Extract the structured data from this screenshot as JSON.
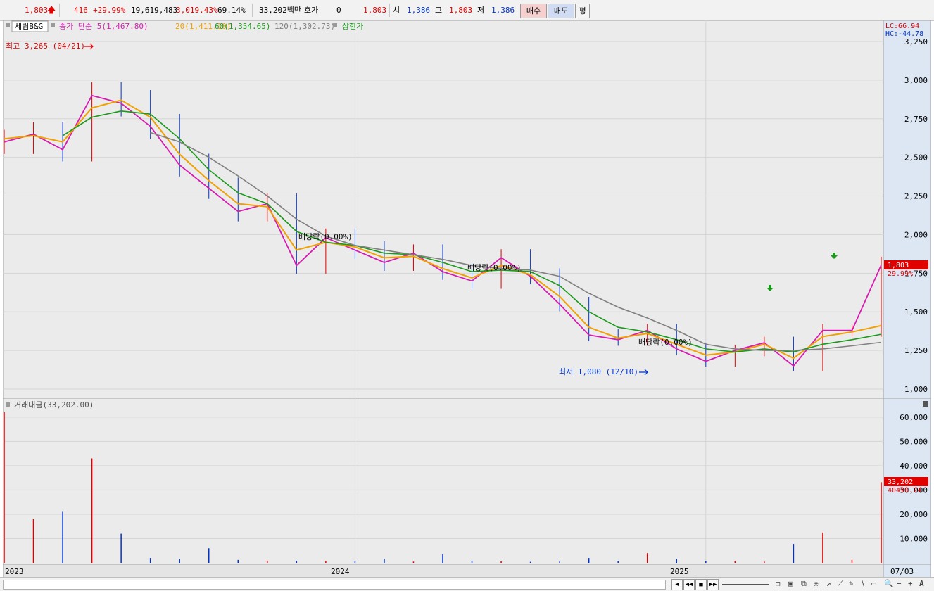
{
  "quote": {
    "price": "1,803",
    "change": "416",
    "change_pct": "+29.99%",
    "volume": "19,619,483",
    "vol_ratio": "3,019.43%",
    "turnover_rate": "69.14%",
    "amount": "33,202백만",
    "bid_label": "호가",
    "bid_value": "0",
    "bid_price": "1,803",
    "open_label": "시",
    "open_value": "1,386",
    "high_label": "고",
    "high_value": "1,803",
    "low_label": "저",
    "low_value": "1,386",
    "buy_label": "매수",
    "sell_label": "매도",
    "eval_label": "평"
  },
  "colors": {
    "up": "#e00000",
    "down": "#0033cc",
    "ma5": "#d81bb0",
    "ma20": "#f0a000",
    "ma60": "#1a9a1a",
    "ma120": "#808080",
    "grid": "#d6d6d6",
    "panel_bg": "#ebebeb",
    "axis_bg": "#dde7f3"
  },
  "price_panel": {
    "legend": {
      "stock_name": "세림B&G",
      "ma_label": "종가 단순 5(1,467.80)",
      "ma20_label": "20(1,411.10)",
      "ma60_label": "60(1,354.65)",
      "ma120_label": "120(1,302.73)",
      "limit_label": "상한가"
    },
    "lc_text": "LC:66.94",
    "hc_text": "HC:-44.78",
    "high_annotation": "최고 3,265 (04/21)",
    "low_annotation": "최저 1,080 (12/10)",
    "dividend_label": "배당락(0.00%)",
    "last_price_tag": "1,803",
    "last_pct_tag": "29.99%"
  },
  "volume_panel": {
    "legend": "거래대금(33,202.00)",
    "last_value_tag": "33,202",
    "ma_value_tag": "40490.24"
  },
  "x_axis": {
    "labels": [
      "2023",
      "2024",
      "2025",
      "07/03"
    ]
  },
  "chart_data": [
    {
      "type": "line",
      "title": "세림B&G",
      "y_ticks": [
        "3,250",
        "3,000",
        "2,750",
        "2,500",
        "2,250",
        "2,000",
        "1,750",
        "1,500",
        "1,250",
        "1,000"
      ],
      "ylim": [
        950,
        3350
      ],
      "x": [
        "2023-01",
        "2023-02",
        "2023-03",
        "2023-04",
        "2023-05",
        "2023-06",
        "2023-07",
        "2023-08",
        "2023-09",
        "2023-10",
        "2023-11",
        "2023-12",
        "2024-01",
        "2024-02",
        "2024-03",
        "2024-04",
        "2024-05",
        "2024-06",
        "2024-07",
        "2024-08",
        "2024-09",
        "2024-10",
        "2024-11",
        "2024-12",
        "2025-01",
        "2025-02",
        "2025-03",
        "2025-04",
        "2025-05",
        "2025-06",
        "2025-07"
      ],
      "series": [
        {
          "name": "종가",
          "values": [
            2600,
            2650,
            2550,
            2900,
            2850,
            2700,
            2450,
            2300,
            2150,
            2200,
            1800,
            1980,
            1900,
            1820,
            1880,
            1760,
            1700,
            1850,
            1730,
            1550,
            1350,
            1320,
            1380,
            1260,
            1180,
            1250,
            1300,
            1150,
            1380,
            1380,
            1803
          ]
        },
        {
          "name": "20",
          "values": [
            2620,
            2640,
            2600,
            2820,
            2870,
            2760,
            2520,
            2350,
            2200,
            2180,
            1900,
            1950,
            1920,
            1850,
            1860,
            1780,
            1720,
            1800,
            1740,
            1600,
            1400,
            1330,
            1360,
            1290,
            1220,
            1240,
            1290,
            1200,
            1340,
            1370,
            1411
          ]
        },
        {
          "name": "60",
          "values": [
            null,
            null,
            2640,
            2760,
            2800,
            2780,
            2620,
            2420,
            2270,
            2200,
            2020,
            1950,
            1930,
            1880,
            1870,
            1820,
            1760,
            1770,
            1760,
            1670,
            1500,
            1400,
            1370,
            1320,
            1260,
            1240,
            1260,
            1240,
            1290,
            1320,
            1355
          ]
        },
        {
          "name": "120",
          "values": [
            null,
            null,
            null,
            null,
            null,
            2660,
            2600,
            2500,
            2380,
            2250,
            2100,
            1990,
            1930,
            1900,
            1870,
            1840,
            1800,
            1780,
            1770,
            1730,
            1620,
            1530,
            1460,
            1380,
            1290,
            1260,
            1250,
            1250,
            1260,
            1280,
            1303
          ]
        }
      ]
    },
    {
      "type": "bar",
      "title": "거래대금",
      "y_ticks": [
        "60,000",
        "50,000",
        "40,000",
        "30,000",
        "20,000",
        "10,000"
      ],
      "ylim": [
        0,
        64000
      ],
      "x": [
        "2023-01",
        "2023-02",
        "2023-03",
        "2023-04",
        "2023-05",
        "2023-06",
        "2023-07",
        "2023-08",
        "2023-09",
        "2023-10",
        "2023-11",
        "2023-12",
        "2024-01",
        "2024-02",
        "2024-03",
        "2024-04",
        "2024-05",
        "2024-06",
        "2024-07",
        "2024-08",
        "2024-09",
        "2024-10",
        "2024-11",
        "2024-12",
        "2025-01",
        "2025-02",
        "2025-03",
        "2025-04",
        "2025-05",
        "2025-06",
        "2025-07"
      ],
      "series": [
        {
          "name": "거래대금",
          "values": [
            62000,
            18000,
            21000,
            43000,
            12000,
            2000,
            1500,
            6000,
            1200,
            900,
            800,
            700,
            600,
            1500,
            500,
            3500,
            700,
            600,
            400,
            500,
            2000,
            800,
            4000,
            1500,
            600,
            700,
            500,
            7800,
            12500,
            1200,
            33202
          ]
        }
      ]
    }
  ]
}
